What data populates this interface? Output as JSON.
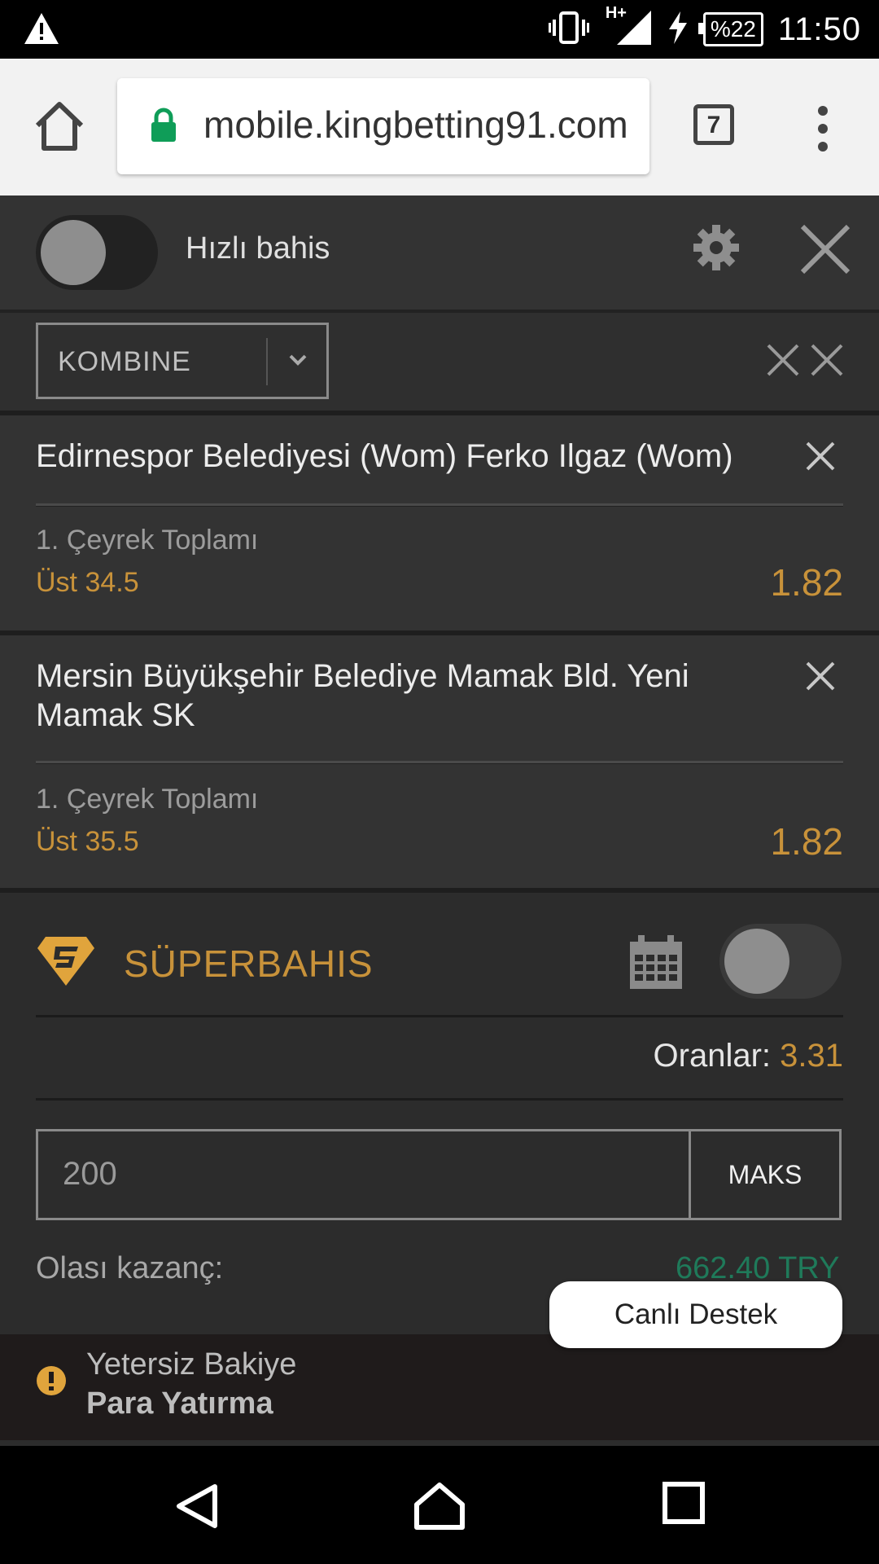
{
  "status_bar": {
    "battery": "%22",
    "network": "H+",
    "time": "11:50"
  },
  "browser": {
    "url": "mobile.kingbetting91.com",
    "tab_count": "7"
  },
  "betslip": {
    "quick_bet_label": "Hızlı bahis",
    "bet_type": "KOMBINE",
    "bets": [
      {
        "teams": "Edirnespor Belediyesi (Wom) Ferko Ilgaz (Wom)",
        "market": "1. Çeyrek Toplamı",
        "selection": "Üst 34.5",
        "odd": "1.82"
      },
      {
        "teams": "Mersin Büyükşehir Belediye Mamak Bld. Yeni Mamak SK",
        "market": "1. Çeyrek Toplamı",
        "selection": "Üst 35.5",
        "odd": "1.82"
      }
    ],
    "super": {
      "title": "SÜPERBAHIS",
      "odds_label": "Oranlar:",
      "odds_value": "3.31",
      "stake": "200",
      "max_label": "MAKS",
      "win_label": "Olası kazanç:",
      "win_value": "662.40 TRY"
    },
    "alert": {
      "message": "Yetersiz Bakiye",
      "action": "Para Yatırma"
    }
  },
  "live_support": "Canlı Destek",
  "colors": {
    "accent": "#c8923a",
    "panel": "#2c2c2c",
    "secure": "#0f9d58"
  }
}
